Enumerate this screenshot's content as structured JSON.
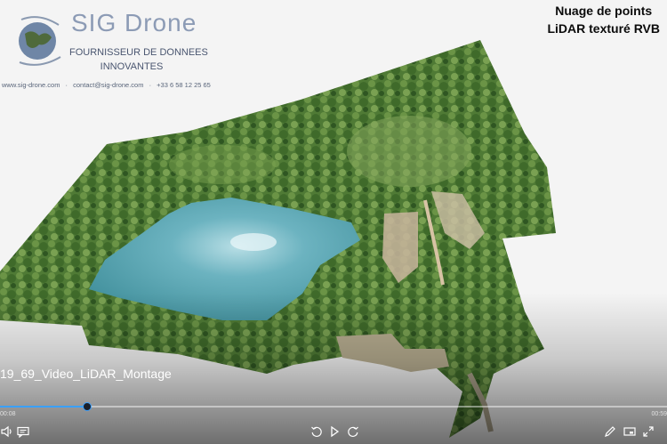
{
  "brand": {
    "name": "SIG Drone",
    "tagline": [
      "FOURNISSEUR DE DONNEES",
      "INNOVANTES"
    ],
    "contact": [
      "www.sig-drone.com",
      "·",
      "contact@sig-drone.com",
      "·",
      "+33 6 58 12 25 65"
    ]
  },
  "overlay_title": [
    "Nuage de points",
    "LiDAR texturé RVB"
  ],
  "player": {
    "video_title": "19_69_Video_LiDAR_Montage",
    "progress": 0.13,
    "time_elapsed": "00:08",
    "time_total": "00:59",
    "controls": {
      "volume": "volume-icon",
      "captions": "captions-icon",
      "rewind": "rewind-10-icon",
      "play": "play-icon",
      "forward": "forward-30-icon",
      "edit": "edit-icon",
      "cast": "cast-icon",
      "fullscreen": "fullscreen-icon"
    }
  },
  "colors": {
    "accent": "#3aa0ff",
    "vegetation": "#4f7a35",
    "water": "#5aa6b4"
  }
}
